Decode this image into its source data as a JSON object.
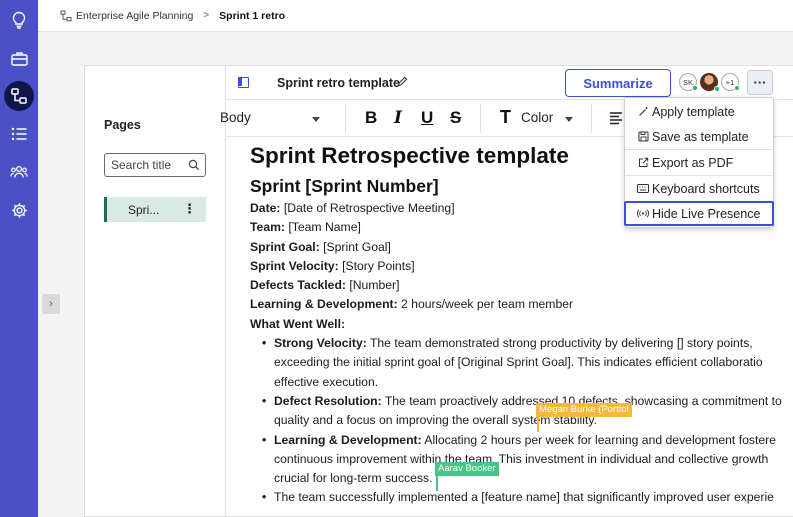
{
  "rail": {
    "icons": [
      "lightbulb-icon",
      "briefcase-icon",
      "hierarchy-icon",
      "list-icon",
      "team-icon",
      "settings-icon"
    ],
    "accent": "#4a51c6",
    "active_bg": "#11154a"
  },
  "breadcrumb": {
    "root": "Enterprise Agile Planning",
    "separator": ">",
    "current": "Sprint 1 retro"
  },
  "pages_panel": {
    "title": "Pages",
    "search_placeholder": "Search title",
    "items": [
      {
        "label": "Spri...",
        "kebab": "⋮"
      }
    ]
  },
  "editor": {
    "doc_title": "Sprint retro template",
    "summarize_label": "Summarize",
    "avatars": {
      "first": "SK",
      "overflow": "+1"
    },
    "more_label": "···",
    "toolbar": {
      "style": "Body",
      "bold": "B",
      "italic": "I",
      "underline": "U",
      "strike": "S",
      "color_icon": "T",
      "color_label": "Color"
    }
  },
  "document": {
    "h1": "Sprint Retrospective template",
    "h2": "Sprint [Sprint Number]",
    "fields": [
      {
        "label": "Date:",
        "value": " [Date of Retrospective Meeting]"
      },
      {
        "label": "Team:",
        "value": " [Team Name]"
      },
      {
        "label": "Sprint Goal:",
        "value": " [Sprint Goal]"
      },
      {
        "label": "Sprint Velocity:",
        "value": " [Story Points]"
      },
      {
        "label": "Defects Tackled:",
        "value": " [Number]"
      },
      {
        "label": "Learning & Development:",
        "value": " 2 hours/week per team member"
      }
    ],
    "section": "What Went Well:",
    "bullets": [
      {
        "label": "Strong Velocity:",
        "lines": [
          " The team demonstrated strong productivity by delivering [] story points,",
          "exceeding the initial sprint goal of [Original Sprint Goal]. This indicates efficient collaboratio",
          "effective execution."
        ]
      },
      {
        "label": "Defect Resolution:",
        "lines": [
          " The team proactively addressed 10 defects, showcasing a commitment to",
          "quality and a focus on improving the overall system stability."
        ]
      },
      {
        "label": "Learning & Development:",
        "lines": [
          " Allocating 2 hours per week for learning and development fostere",
          "continuous improvement within the team. This investment in individual and collective growth",
          "crucial for long-term success."
        ]
      },
      {
        "label": "",
        "lines": [
          "The team successfully implemented a [feature name] that significantly improved user experie"
        ]
      }
    ]
  },
  "presence": {
    "megan": {
      "name": "Megan Burke (Portfol",
      "color": "#f5b83c"
    },
    "aarav": {
      "name": "Aarav Booker",
      "color": "#48c487"
    }
  },
  "menu": {
    "items": [
      {
        "label": "Apply template",
        "icon": "magic-wand-icon"
      },
      {
        "label": "Save as template",
        "icon": "save-icon"
      },
      {
        "label": "Export as PDF",
        "icon": "export-icon"
      },
      {
        "label": "Keyboard shortcuts",
        "icon": "keyboard-icon"
      },
      {
        "label": "Hide Live Presence",
        "icon": "broadcast-icon"
      }
    ],
    "focus_color": "#3d4fd8"
  }
}
